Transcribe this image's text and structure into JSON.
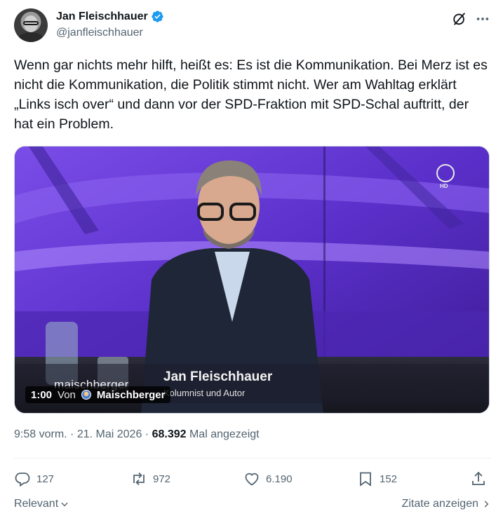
{
  "author": {
    "display_name": "Jan Fleischhauer",
    "handle": "@janfleischhauer",
    "verified_color": "#1d9bf0"
  },
  "tweet": {
    "text": "Wenn gar nichts mehr hilft, heißt es: Es ist die Kommunikation. Bei Merz ist es nicht die Kommunikation, die Politik stimmt nicht. Wer am Wahltag erklärt „Links isch over“ und dann vor der SPD-Fraktion mit SPD-Schal auftritt, der hat ein Problem."
  },
  "media": {
    "lower_third_name": "Jan Fleischhauer",
    "lower_third_role": "Kolumnist und Autor",
    "show_logo": "maischberger",
    "channel_badge": "HD",
    "duration": "1:00",
    "from_label": "Von",
    "source": "Maischberger"
  },
  "meta": {
    "time": "9:58 vorm.",
    "separator": "·",
    "date": "21. Mai 2026",
    "views": "68.392",
    "views_label": "Mal angezeigt"
  },
  "actions": {
    "replies": "127",
    "reposts": "972",
    "likes": "6.190",
    "bookmarks": "152"
  },
  "footer": {
    "sort_label": "Relevant",
    "quotes_label": "Zitate anzeigen"
  },
  "icons": [
    "verified-icon",
    "grok-icon",
    "more-icon",
    "reply-icon",
    "repost-icon",
    "like-icon",
    "bookmark-icon",
    "share-icon",
    "chevron-down-icon",
    "chevron-right-icon"
  ],
  "colors": {
    "text": "#0f1419",
    "secondary": "#536471",
    "accent": "#1d9bf0"
  }
}
